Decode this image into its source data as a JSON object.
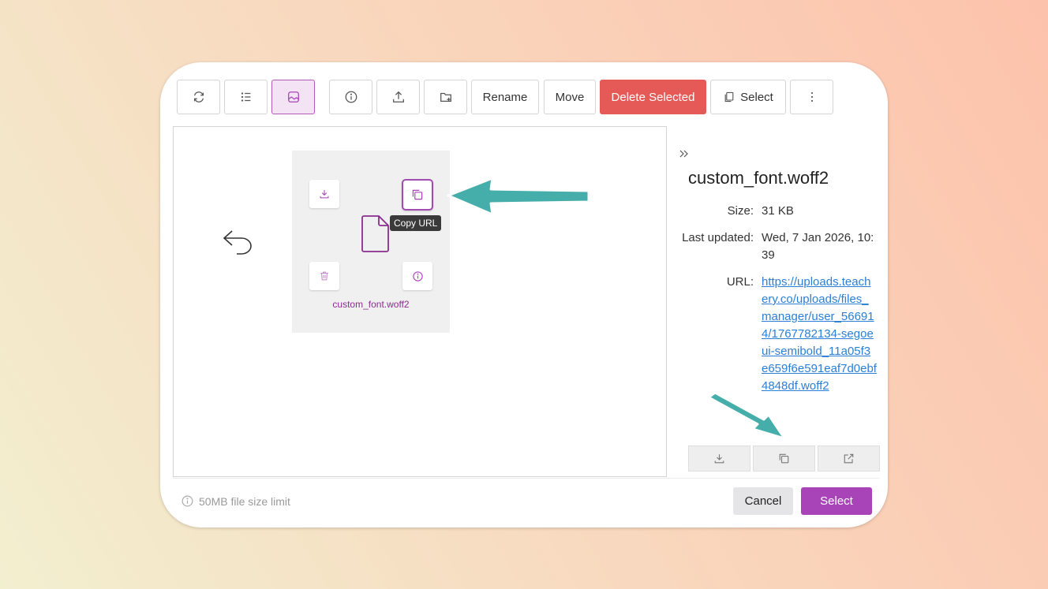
{
  "toolbar": {
    "rename_label": "Rename",
    "move_label": "Move",
    "delete_label": "Delete Selected",
    "select_label": "Select"
  },
  "file": {
    "name": "custom_font.woff2",
    "tooltip": "Copy URL"
  },
  "details": {
    "title": "custom_font.woff2",
    "size_key": "Size:",
    "size_value": "31 KB",
    "updated_key": "Last updated:",
    "updated_value": "Wed, 7 Jan 2026, 10:39",
    "url_key": "URL:",
    "url_value": "https://uploads.teachery.co/uploads/files_manager/user_566914/1767782134-segoeui-semibold_11a05f3e659f6e591eaf7d0ebf4848df.woff2"
  },
  "footer": {
    "limit_text": "50MB file size limit",
    "cancel_label": "Cancel",
    "select_label": "Select"
  },
  "colors": {
    "accent": "#a844b8",
    "danger": "#e55a57",
    "annotation_arrow": "#45adaa",
    "link": "#2b7fd6"
  }
}
